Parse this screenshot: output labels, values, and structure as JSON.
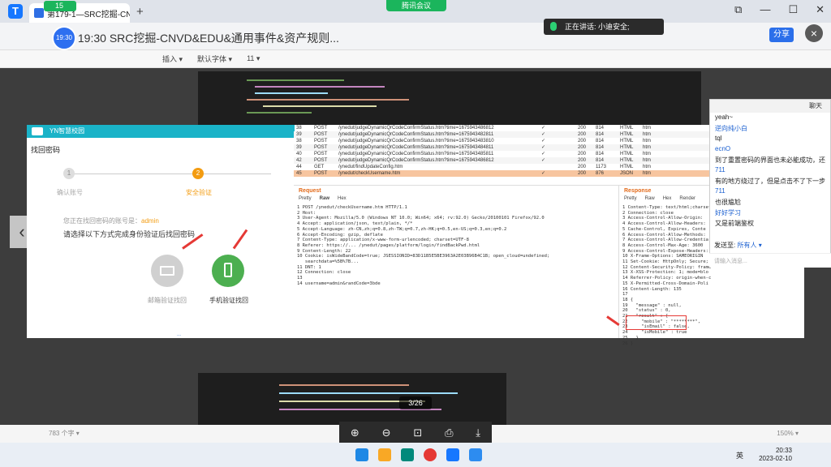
{
  "browser": {
    "tab_label": "第179-1—SRC挖掘-CNVD...",
    "tab_close": "×",
    "new_tab": "+",
    "meeting_label": "腾讯会议",
    "record_time": "15",
    "window_controls": [
      "⧉",
      "—",
      "☐",
      "✕"
    ]
  },
  "document": {
    "title": "第   19:30   SRC挖掘-CNVD&EDU&通用事件&资产规则...",
    "avatar_text": "19:30",
    "share_label": "分享",
    "close_symbol": "×",
    "toolbar_items": [
      "插入 ▾",
      "",
      "默认字体 ▾",
      "11 ▾",
      "",
      "",
      "",
      "",
      "",
      "",
      ""
    ]
  },
  "speaking": {
    "text": "正在讲话: 小迪安全;"
  },
  "yn_page": {
    "brand": "YN智慧校园",
    "heading": "找回密码",
    "step1_num": "1",
    "step1_label": "确认账号",
    "step2_num": "2",
    "step2_label": "安全验证",
    "account_prefix": "您正在找回密码的账号是：",
    "account_name": "admin",
    "instruction": "请选择以下方式完成身份验证后找回密码",
    "email_option": "邮箱验证找回",
    "phone_option": "手机验证找回",
    "footer_link": "..."
  },
  "http_history": {
    "rows": [
      {
        "num": "38",
        "method": "POST",
        "url": "/ynedut/judgeDynamicQrCodeConfirmStatus.htm?time=1675943486812",
        "check": "✓",
        "status": "200",
        "length": "814",
        "mime": "HTML",
        "ext": "htm",
        "selected": false
      },
      {
        "num": "39",
        "method": "POST",
        "url": "/ynedut/judgeDynamicQrCodeConfirmStatus.htm?time=1675943482811",
        "check": "✓",
        "status": "200",
        "length": "814",
        "mime": "HTML",
        "ext": "htm",
        "selected": false
      },
      {
        "num": "38",
        "method": "POST",
        "url": "/ynedut/judgeDynamicQrCodeConfirmStatus.htm?time=1675943483810",
        "check": "✓",
        "status": "200",
        "length": "814",
        "mime": "HTML",
        "ext": "htm",
        "selected": false
      },
      {
        "num": "39",
        "method": "POST",
        "url": "/ynedut/judgeDynamicQrCodeConfirmStatus.htm?time=1675943484811",
        "check": "✓",
        "status": "200",
        "length": "814",
        "mime": "HTML",
        "ext": "htm",
        "selected": false
      },
      {
        "num": "40",
        "method": "POST",
        "url": "/ynedut/judgeDynamicQrCodeConfirmStatus.htm?time=1675943485811",
        "check": "✓",
        "status": "200",
        "length": "814",
        "mime": "HTML",
        "ext": "htm",
        "selected": false
      },
      {
        "num": "42",
        "method": "POST",
        "url": "/ynedut/judgeDynamicQrCodeConfirmStatus.htm?time=1675943486812",
        "check": "✓",
        "status": "200",
        "length": "814",
        "mime": "HTML",
        "ext": "htm",
        "selected": false
      },
      {
        "num": "44",
        "method": "GET",
        "url": "/ynedut/findUpdateConfig.htm",
        "check": "",
        "status": "200",
        "length": "1173",
        "mime": "HTML",
        "ext": "htm",
        "selected": false
      },
      {
        "num": "45",
        "method": "POST",
        "url": "/ynedut/checkUsername.htm",
        "check": "✓",
        "status": "200",
        "length": "876",
        "mime": "JSON",
        "ext": "htm",
        "selected": true
      }
    ]
  },
  "request": {
    "title": "Request",
    "tabs": [
      "Pretty",
      "Raw",
      "Hex"
    ],
    "lines": [
      "1 POST /ynedut/checkUsername.htm HTTP/1.1",
      "2 Host: ",
      "3 User-Agent: Mozilla/5.0 (Windows NT 10.0; Win64; x64; rv:92.0) Gecko/20100101 Firefox/92.0",
      "4 Accept: application/json, text/plain, */*",
      "5 Accept-Language: zh-CN,zh;q=0.8,zh-TW;q=0.7,zh-HK;q=0.5,en-US;q=0.3,en;q=0.2",
      "6 Accept-Encoding: gzip, deflate",
      "7 Content-Type: application/x-www-form-urlencoded; charset=UTF-8",
      "8 Referer: https://... /ynedut/pages/platform/login/findBackPwd.html",
      "9 Content-Length: 22",
      "10 Cookie: isWideBandCode=true; JSESSIONID=83D11B5E5BE3963A2E03B96B4C1B; open_cloud=undefined;",
      "   searchdata=%5B%7B...",
      "11 DNT: 1",
      "12 Connection: close",
      "13 ",
      "14 username=admin&randCode=3bde"
    ]
  },
  "response": {
    "title": "Response",
    "tabs": [
      "Pretty",
      "Raw",
      "Hex",
      "Render"
    ],
    "lines": [
      "1 Content-Type: text/html;charset",
      "2 Connection: close",
      "3 Access-Control-Allow-Origin: ",
      "4 Access-Control-Allow-Headers: ",
      "5 Cache-Control, Expires, Conte",
      "6 Access-Control-Allow-Methods: ",
      "7 Access-Control-Allow-Credentia",
      "8 Access-Control-Max-Age: 3600",
      "9 Access-Control-Expose-Headers:",
      "10 X-Frame-Options: SAMEORIGIN",
      "11 Set-Cookie: HttpOnly; Secure; Pa",
      "12 Content-Security-Policy: frame",
      "13 X-XSS-Protection: 1; mode=blo",
      "14 Referrer-Policy: origin-when-c",
      "15 X-Permitted-Cross-Domain-Poli",
      "16 Content-Length: 135",
      "17 ",
      "18 {",
      "19   \"message\" : null,",
      "20   \"status\" : 0,",
      "21   \"result\" : {",
      "22     \"mobile\" : \"********\",",
      "23     \"isEmail\" : false,",
      "24     \"isMobile\" : true",
      "25   }",
      "26 }"
    ]
  },
  "chat": {
    "title": "聊天",
    "messages": [
      {
        "text": "yeah~",
        "color": "#222"
      },
      {
        "text": "逆向纯小白",
        "color": "#1a5fd0"
      },
      {
        "text": "tql",
        "color": "#222"
      },
      {
        "text": "ecnO",
        "color": "#1a5fd0"
      },
      {
        "text": "到了重置密码的界面也未必能成功，还",
        "color": "#222"
      },
      {
        "text": "711",
        "color": "#1a5fd0"
      },
      {
        "text": "有的地方绕过了，但是点击不了下一步",
        "color": "#222"
      },
      {
        "text": "711",
        "color": "#1a5fd0"
      },
      {
        "text": "也很尴尬",
        "color": "#222"
      },
      {
        "text": "好好学习",
        "color": "#1a5fd0"
      },
      {
        "text": "又是前端鉴权",
        "color": "#222"
      }
    ],
    "send_to_label": "发送至:",
    "send_to_value": "所有人 ▾",
    "input_placeholder": "请输入消息..."
  },
  "viewer": {
    "page_indicator": "3/26",
    "tools": [
      "⊕",
      "⊖",
      "⊡",
      "⎙",
      "⤓"
    ]
  },
  "status": {
    "left_text": "783 个字 ▾",
    "zoom": "150% ▾"
  },
  "taskbar": {
    "time": "20:33",
    "date": "2023-02-10",
    "lang": "英"
  }
}
